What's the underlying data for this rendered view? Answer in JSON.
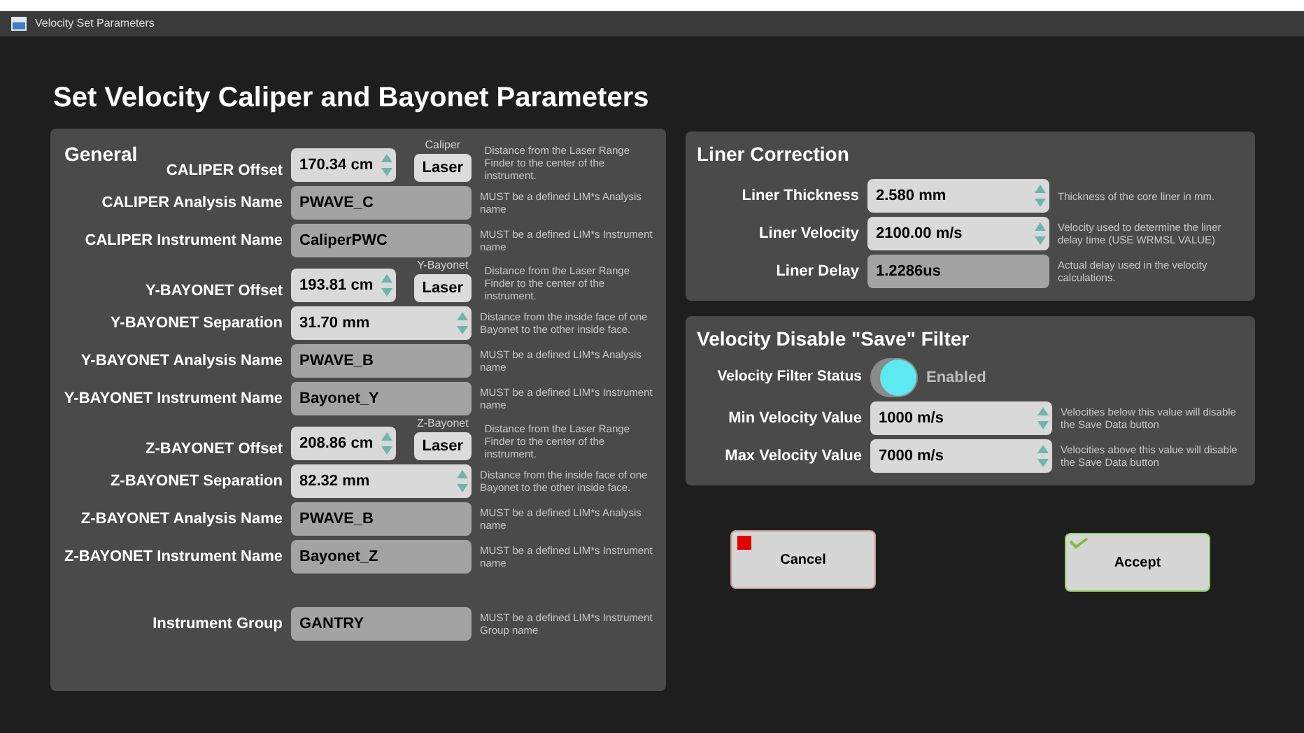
{
  "window": {
    "title": "Velocity Set Parameters"
  },
  "heading": "Set Velocity Caliper and Bayonet Parameters",
  "general": {
    "title": "General",
    "sections": [
      {
        "rows": [
          {
            "kind": "offset",
            "caption": "Caliper",
            "label": "CALIPER Offset",
            "value": "170.34 cm",
            "button": "Laser",
            "description": "Distance from the Laser Range Finder  to the center of the instrument."
          },
          {
            "kind": "text",
            "label": "CALIPER Analysis Name",
            "value": "PWAVE_C",
            "description": "MUST be a defined LIM*s Analysis name"
          },
          {
            "kind": "text",
            "label": "CALIPER Instrument Name",
            "value": "CaliperPWC",
            "description": "MUST be a defined LIM*s Instrument name"
          }
        ]
      },
      {
        "rows": [
          {
            "kind": "offset",
            "caption": "Y-Bayonet",
            "label": "Y-BAYONET Offset",
            "value": "193.81 cm",
            "button": "Laser",
            "description": "Distance from the Laser Range Finder  to the center of the instrument."
          },
          {
            "kind": "spin",
            "label": "Y-BAYONET Separation",
            "value": "31.70 mm",
            "description": "Distance from the inside face of one Bayonet to the other inside face."
          },
          {
            "kind": "text",
            "label": "Y-BAYONET Analysis Name",
            "value": "PWAVE_B",
            "description": "MUST be a defined LIM*s Analysis name"
          },
          {
            "kind": "text",
            "label": "Y-BAYONET Instrument Name",
            "value": "Bayonet_Y",
            "description": "MUST be a defined LIM*s Instrument name"
          }
        ]
      },
      {
        "rows": [
          {
            "kind": "offset",
            "caption": "Z-Bayonet",
            "label": "Z-BAYONET Offset",
            "value": "208.86 cm",
            "button": "Laser",
            "description": "Distance from the Laser Range Finder  to the center of the instrument."
          },
          {
            "kind": "spin",
            "label": "Z-BAYONET Separation",
            "value": "82.32 mm",
            "description": "Distance from the inside face of one Bayonet to the other inside face."
          },
          {
            "kind": "text",
            "label": "Z-BAYONET Analysis Name",
            "value": "PWAVE_B",
            "description": "MUST be a defined LIM*s Analysis name"
          },
          {
            "kind": "text",
            "label": "Z-BAYONET Instrument Name",
            "value": "Bayonet_Z",
            "description": "MUST be a defined LIM*s Instrument name"
          }
        ]
      },
      {
        "rows": [
          {
            "kind": "text",
            "label": "Instrument Group",
            "value": "GANTRY",
            "description": "MUST be a defined LIM*s Instrument Group name"
          }
        ]
      }
    ]
  },
  "liner": {
    "title": "Liner Correction",
    "rows": [
      {
        "kind": "spin",
        "label": "Liner Thickness",
        "value": "2.580 mm",
        "description": "Thickness of the core liner in mm."
      },
      {
        "kind": "spin",
        "label": "Liner Velocity",
        "value": "2100.00 m/s",
        "description": "Velocity used to determine the liner delay time (USE WRMSL VALUE)"
      },
      {
        "kind": "text",
        "label": "Liner Delay",
        "value": "1.2286us",
        "description": "Actual delay used in the velocity calculations."
      }
    ]
  },
  "filter": {
    "title": "Velocity Disable \"Save\" Filter",
    "status": {
      "label": "Velocity Filter Status",
      "on": true,
      "text": "Enabled"
    },
    "rows": [
      {
        "kind": "spin",
        "label": "Min Velocity Value",
        "value": "1000 m/s",
        "description": "Velocities below this value will disable the Save Data button"
      },
      {
        "kind": "spin",
        "label": "Max Velocity Value",
        "value": "7000 m/s",
        "description": "Velocities above this value will disable the Save Data button"
      }
    ]
  },
  "buttons": [
    {
      "kind": "cancel",
      "label": "Cancel"
    },
    {
      "kind": "accept",
      "label": "Accept"
    }
  ]
}
